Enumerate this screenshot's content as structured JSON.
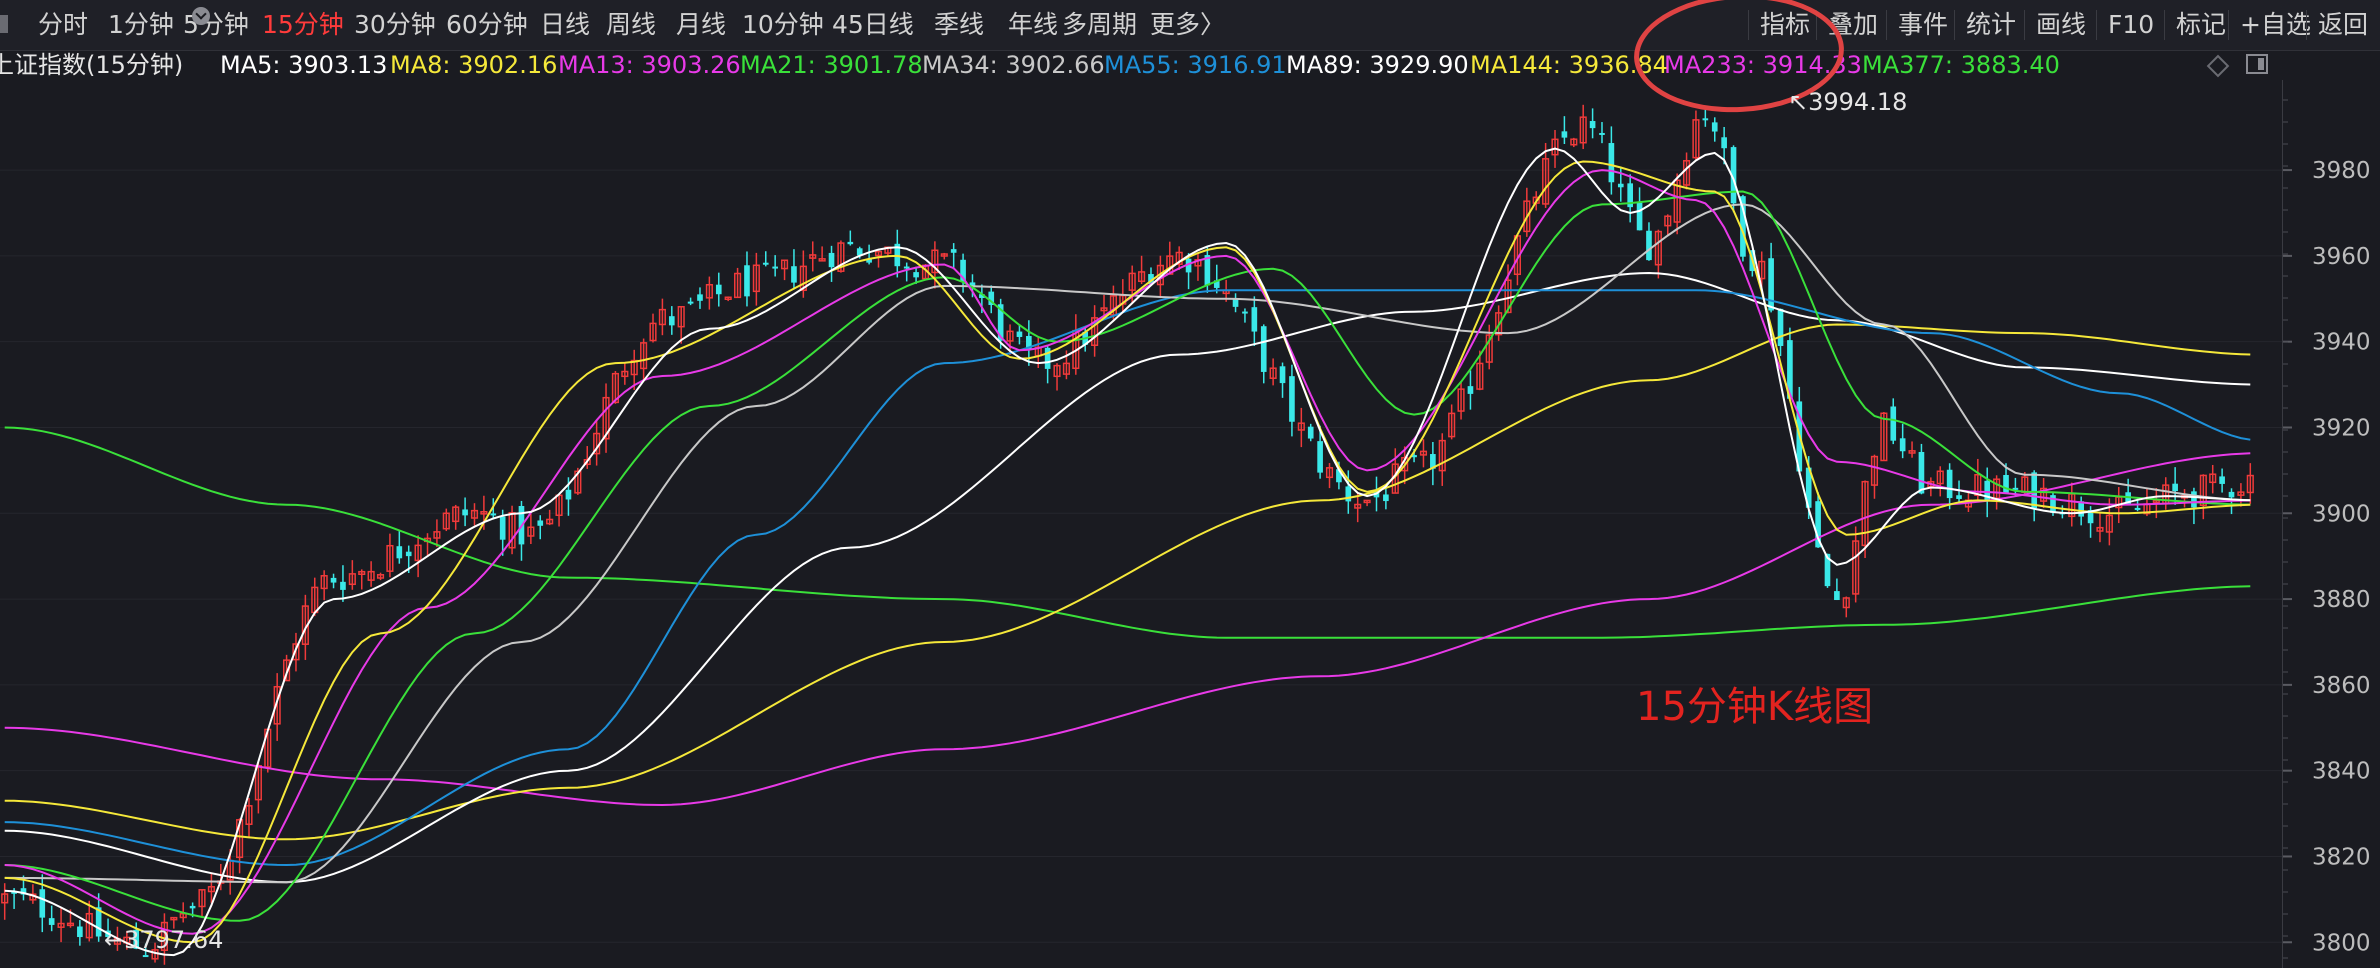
{
  "toolbar": {
    "periods": [
      "分时",
      "1分钟",
      "5分钟",
      "15分钟",
      "30分钟",
      "60分钟",
      "日线",
      "周线",
      "月线",
      "10分钟",
      "45日线",
      "季线",
      "年线",
      "多周期",
      "更多〉"
    ],
    "active_period": "15分钟",
    "tools": [
      "指标",
      "叠加",
      "事件",
      "统计",
      "画线",
      "F10",
      "标记",
      "+自选",
      "返回"
    ]
  },
  "infobar": {
    "title": "上证指数(15分钟)",
    "ma": [
      {
        "label": "MA5: 3903.13",
        "color": "#ffffff"
      },
      {
        "label": "MA8: 3902.16",
        "color": "#f5e83a"
      },
      {
        "label": "MA13: 3903.26",
        "color": "#e83ae8"
      },
      {
        "label": "MA21: 3901.78",
        "color": "#3ae03a"
      },
      {
        "label": "MA34: 3902.66",
        "color": "#c8c8c8"
      },
      {
        "label": "MA55: 3916.91",
        "color": "#1e90d8"
      },
      {
        "label": "MA89: 3929.90",
        "color": "#ffffff"
      },
      {
        "label": "MA144: 3936.84",
        "color": "#f5e83a"
      },
      {
        "label": "MA233: 3914.33",
        "color": "#e83ae8"
      },
      {
        "label": "MA377: 3883.40",
        "color": "#3ae03a"
      }
    ]
  },
  "annotation": "15分钟K线图",
  "extremes": {
    "high_label": "3994.18",
    "low_label": "3797.64"
  },
  "chart_data": {
    "type": "line",
    "title": "",
    "y_axis_ticks": [
      3800,
      3820,
      3840,
      3860,
      3880,
      3900,
      3920,
      3940,
      3960,
      3980
    ],
    "ylim": [
      3794,
      4001
    ],
    "x_count": 240,
    "candles_description": "15-minute candlesticks, red = up, cyan = down",
    "up_color": "#f03a3a",
    "down_color": "#3ae8e8",
    "series": [
      {
        "name": "MA377",
        "color": "#3ae03a",
        "anchors": [
          [
            0,
            3920
          ],
          [
            30,
            3902
          ],
          [
            60,
            3885
          ],
          [
            100,
            3880
          ],
          [
            130,
            3871
          ],
          [
            170,
            3871
          ],
          [
            200,
            3874
          ],
          [
            240,
            3883
          ]
        ]
      },
      {
        "name": "MA233",
        "color": "#e83ae8",
        "anchors": [
          [
            0,
            3850
          ],
          [
            40,
            3838
          ],
          [
            70,
            3832
          ],
          [
            100,
            3845
          ],
          [
            140,
            3862
          ],
          [
            175,
            3880
          ],
          [
            205,
            3902
          ],
          [
            240,
            3914
          ]
        ]
      },
      {
        "name": "MA144",
        "color": "#f5e83a",
        "anchors": [
          [
            0,
            3833
          ],
          [
            30,
            3824
          ],
          [
            60,
            3836
          ],
          [
            100,
            3870
          ],
          [
            140,
            3903
          ],
          [
            175,
            3931
          ],
          [
            195,
            3944
          ],
          [
            215,
            3942
          ],
          [
            240,
            3937
          ]
        ]
      },
      {
        "name": "MA89",
        "color": "#ffffff",
        "anchors": [
          [
            0,
            3826
          ],
          [
            30,
            3814
          ],
          [
            60,
            3840
          ],
          [
            90,
            3892
          ],
          [
            125,
            3937
          ],
          [
            150,
            3947
          ],
          [
            175,
            3956
          ],
          [
            195,
            3945
          ],
          [
            215,
            3934
          ],
          [
            240,
            3930
          ]
        ]
      },
      {
        "name": "MA55",
        "color": "#1e90d8",
        "anchors": [
          [
            0,
            3828
          ],
          [
            30,
            3818
          ],
          [
            60,
            3845
          ],
          [
            80,
            3895
          ],
          [
            100,
            3935
          ],
          [
            130,
            3952
          ],
          [
            180,
            3952
          ],
          [
            205,
            3942
          ],
          [
            225,
            3928
          ],
          [
            240,
            3917
          ]
        ]
      },
      {
        "name": "MA34",
        "color": "#c8c8c8",
        "anchors": [
          [
            0,
            3815
          ],
          [
            30,
            3814
          ],
          [
            55,
            3870
          ],
          [
            80,
            3925
          ],
          [
            100,
            3953
          ],
          [
            130,
            3950
          ],
          [
            160,
            3942
          ],
          [
            185,
            3972
          ],
          [
            200,
            3944
          ],
          [
            215,
            3909
          ],
          [
            240,
            3903
          ]
        ]
      },
      {
        "name": "MA21",
        "color": "#3ae03a",
        "anchors": [
          [
            0,
            3818
          ],
          [
            25,
            3805
          ],
          [
            50,
            3872
          ],
          [
            75,
            3925
          ],
          [
            100,
            3955
          ],
          [
            112,
            3940
          ],
          [
            135,
            3957
          ],
          [
            150,
            3923
          ],
          [
            170,
            3972
          ],
          [
            185,
            3975
          ],
          [
            200,
            3922
          ],
          [
            215,
            3905
          ],
          [
            240,
            3902
          ]
        ]
      },
      {
        "name": "MA13",
        "color": "#e83ae8",
        "anchors": [
          [
            0,
            3818
          ],
          [
            20,
            3802
          ],
          [
            45,
            3878
          ],
          [
            70,
            3932
          ],
          [
            100,
            3958
          ],
          [
            108,
            3938
          ],
          [
            130,
            3960
          ],
          [
            145,
            3910
          ],
          [
            170,
            3980
          ],
          [
            180,
            3973
          ],
          [
            195,
            3912
          ],
          [
            210,
            3905
          ],
          [
            225,
            3902
          ],
          [
            240,
            3903
          ]
        ]
      },
      {
        "name": "MA8",
        "color": "#f5e83a",
        "anchors": [
          [
            0,
            3815
          ],
          [
            20,
            3800
          ],
          [
            40,
            3872
          ],
          [
            65,
            3935
          ],
          [
            95,
            3960
          ],
          [
            108,
            3936
          ],
          [
            130,
            3962
          ],
          [
            145,
            3905
          ],
          [
            168,
            3982
          ],
          [
            182,
            3975
          ],
          [
            196,
            3895
          ],
          [
            210,
            3903
          ],
          [
            225,
            3900
          ],
          [
            240,
            3902
          ]
        ]
      },
      {
        "name": "MA5",
        "color": "#ffffff",
        "anchors": [
          [
            0,
            3812
          ],
          [
            18,
            3797
          ],
          [
            35,
            3880
          ],
          [
            55,
            3900
          ],
          [
            75,
            3943
          ],
          [
            95,
            3962
          ],
          [
            110,
            3935
          ],
          [
            130,
            3963
          ],
          [
            145,
            3904
          ],
          [
            165,
            3985
          ],
          [
            173,
            3970
          ],
          [
            182,
            3984
          ],
          [
            195,
            3888
          ],
          [
            205,
            3906
          ],
          [
            220,
            3900
          ],
          [
            230,
            3904
          ],
          [
            240,
            3903
          ]
        ]
      }
    ],
    "close_anchors": [
      [
        0,
        3810
      ],
      [
        15,
        3799
      ],
      [
        20,
        3808
      ],
      [
        35,
        3885
      ],
      [
        50,
        3900
      ],
      [
        56,
        3895
      ],
      [
        70,
        3945
      ],
      [
        80,
        3954
      ],
      [
        90,
        3962
      ],
      [
        100,
        3958
      ],
      [
        110,
        3935
      ],
      [
        125,
        3960
      ],
      [
        145,
        3903
      ],
      [
        150,
        3910
      ],
      [
        168,
        3990
      ],
      [
        175,
        3963
      ],
      [
        181,
        3994
      ],
      [
        186,
        3960
      ],
      [
        195,
        3880
      ],
      [
        200,
        3920
      ],
      [
        205,
        3906
      ],
      [
        215,
        3905
      ],
      [
        225,
        3900
      ],
      [
        233,
        3905
      ],
      [
        240,
        3908
      ]
    ],
    "high_label": "3994.18",
    "low_label": "3797.64"
  }
}
